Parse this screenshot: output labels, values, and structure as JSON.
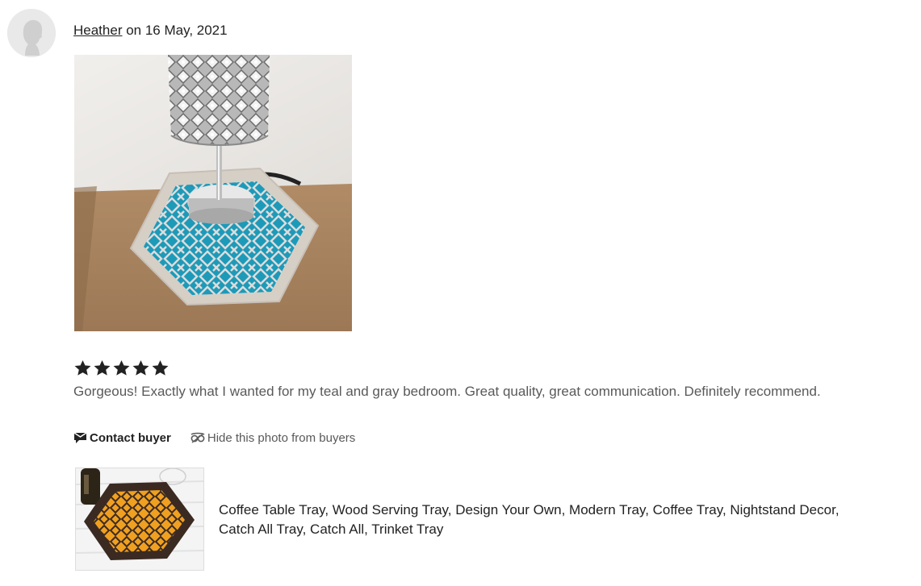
{
  "review": {
    "reviewer": "Heather",
    "on_text": " on 16 May, 2021",
    "rating": 5,
    "rating_max": 5,
    "text": "Gorgeous! Exactly what I wanted for my teal and gray bedroom. Great quality, great communication. Definitely recommend.",
    "photo_icon": "review-photo",
    "colors": {
      "star": "#222222",
      "text_muted": "#595959",
      "photo_teal": "#1d9ab8"
    }
  },
  "actions": {
    "contact_label": "Contact buyer",
    "contact_icon": "message-icon",
    "hide_label": "Hide this photo from buyers",
    "hide_icon": "eye-slash-icon"
  },
  "listing": {
    "title": "Coffee Table Tray, Wood Serving Tray, Design Your Own, Modern Tray, Coffee Tray, Nightstand Decor, Catch All Tray, Catch All, Trinket Tray",
    "thumbnail_colors": {
      "frame": "#3a2a22",
      "pattern": "#f0a020"
    }
  }
}
